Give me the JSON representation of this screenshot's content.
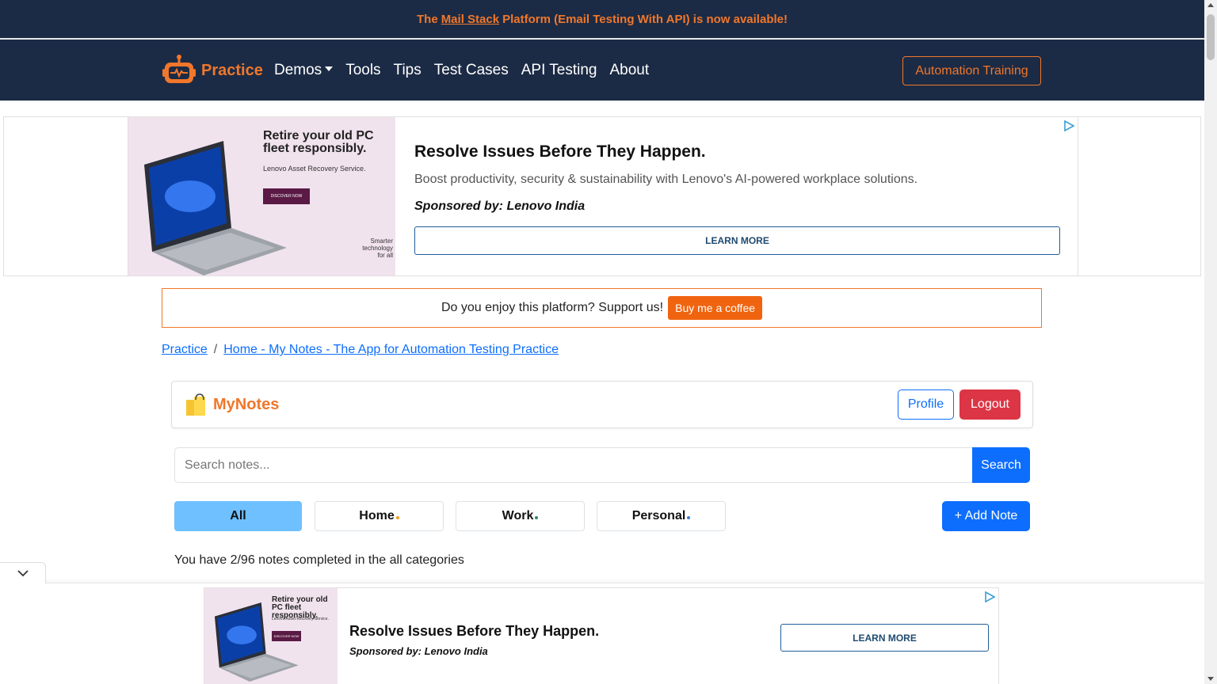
{
  "announcement": {
    "prefix": "The",
    "link": "Mail Stack",
    "suffix": "Platform (Email Testing With API) is now available!"
  },
  "navbar": {
    "brand": "Practice",
    "links": [
      "Demos",
      "Tools",
      "Tips",
      "Test Cases",
      "API Testing",
      "About"
    ],
    "cta": "Automation Training"
  },
  "ad_top": {
    "image_headline": "Retire your old PC fleet responsibly.",
    "image_sub": "Lenovo Asset Recovery Service.",
    "image_button": "DISCOVER NOW",
    "image_footer": "Smarter technology for all",
    "title": "Resolve Issues Before They Happen.",
    "description": "Boost productivity, security & sustainability with Lenovo's AI-powered workplace solutions.",
    "sponsor": "Sponsored by: Lenovo India",
    "cta": "LEARN MORE"
  },
  "support": {
    "text": "Do you enjoy this platform? Support us!",
    "button": "Buy me a coffee"
  },
  "breadcrumb": {
    "root": "Practice",
    "separator": "/",
    "current": "Home - My Notes - The App for Automation Testing Practice"
  },
  "notes_app": {
    "logo_text": "MyNotes",
    "profile_label": "Profile",
    "logout_label": "Logout",
    "search_placeholder": "Search notes...",
    "search_button": "Search",
    "categories": [
      {
        "label": "All",
        "dot_color": ""
      },
      {
        "label": "Home",
        "dot_color": "#f0a020"
      },
      {
        "label": "Work",
        "dot_color": "#2d8a6a"
      },
      {
        "label": "Personal",
        "dot_color": "#3a7bd5"
      }
    ],
    "add_note_label": "+ Add Note",
    "progress_text": "You have 2/96 notes completed in the all categories"
  },
  "ad_bottom": {
    "image_headline": "Retire your old PC fleet responsibly.",
    "image_sub": "Lenovo Asset Recovery Service.",
    "image_button": "DISCOVER NOW",
    "title": "Resolve Issues Before They Happen.",
    "sponsor": "Sponsored by: Lenovo India",
    "cta": "LEARN MORE"
  },
  "colors": {
    "navbar_bg": "#1c2b45",
    "accent_orange": "#f0772b",
    "primary_blue": "#0d6efd",
    "danger_red": "#dc3545",
    "active_category": "#6ec0ff"
  }
}
